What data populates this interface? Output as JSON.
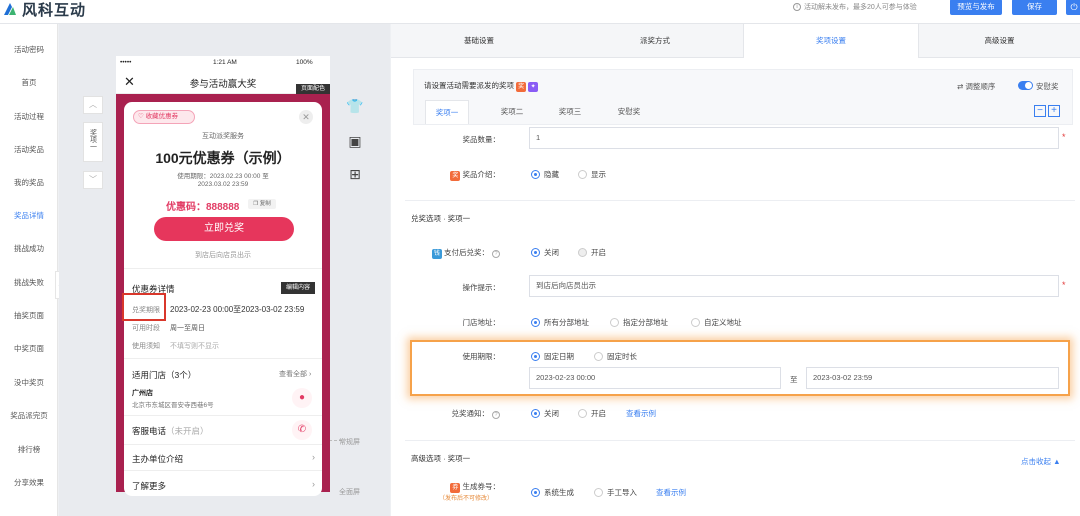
{
  "app": {
    "logo_text": "风科互动",
    "notice": "活动解未发布，最多20人可参与体验",
    "btn_preview": "预览与发布",
    "btn_save": "保存",
    "power_icon": "power-icon"
  },
  "sidebar": {
    "items": [
      {
        "label": "活动密码"
      },
      {
        "label": "首页"
      },
      {
        "label": "活动过程"
      },
      {
        "label": "活动奖品"
      },
      {
        "label": "我的奖品"
      },
      {
        "label": "奖品详情",
        "active": true
      },
      {
        "label": "挑战成功"
      },
      {
        "label": "挑战失败"
      },
      {
        "label": "抽奖页面"
      },
      {
        "label": "中奖页面"
      },
      {
        "label": "没中奖页"
      },
      {
        "label": "奖品派完页"
      },
      {
        "label": "排行榜"
      },
      {
        "label": "分享效果"
      }
    ],
    "collapse": "«"
  },
  "canvas": {
    "prize_tab": "奖项一",
    "normal_screen": "常规屏",
    "full_screen": "全面屏"
  },
  "phone": {
    "carrier": "•••••",
    "time": "1:21 AM",
    "battery": "100%",
    "nav_title": "参与活动赢大奖",
    "page_color": "页面配色",
    "coupon_tag": "收藏优惠券",
    "service": "互动派奖服务",
    "coupon_title": "100元优惠券（示例）",
    "validity_line1": "使用期限：2023.02.23 00:00 至",
    "validity_line2": "2023.03.02 23:59",
    "redeem_code": "优惠码：888888",
    "copy": "复制",
    "redeem_btn": "立即兑奖",
    "redeem_hint": "到店后向店员出示",
    "detail_title": "优惠券详情",
    "edit_btn": "编辑内容",
    "redeem_period_label": "兑奖期限",
    "redeem_period_value": "2023-02-23 00:00至2023-03-02 23:59",
    "avail_label": "可用时段",
    "avail_value": "周一至周日",
    "notice_label": "使用须知",
    "notice_value": "不填写则不显示",
    "stores_title": "适用门店（3个）",
    "view_all": "查看全部",
    "store_name": "广州店",
    "store_addr": "北京市东城区晋安寺西巷6号",
    "service_phone": "客服电话",
    "service_phone_status": "（未开启）",
    "sponsor": "主办单位介绍",
    "more": "了解更多"
  },
  "tabs": [
    {
      "label": "基础设置"
    },
    {
      "label": "派奖方式"
    },
    {
      "label": "奖项设置",
      "active": true
    },
    {
      "label": "高级设置"
    }
  ],
  "prize_panel": {
    "title": "请设置活动需要派发的奖项",
    "reorder": "调整顺序",
    "consolation": "安慰奖",
    "subtabs": [
      {
        "label": "奖项一",
        "active": true
      },
      {
        "label": "奖项二"
      },
      {
        "label": "奖项三"
      },
      {
        "label": "安慰奖"
      }
    ],
    "minus": "−",
    "plus": "+"
  },
  "form": {
    "quantity_label": "奖品数量：",
    "quantity_value": "1",
    "intro_label": "奖品介绍：",
    "intro_hide": "隐藏",
    "intro_show": "显示",
    "redeem_section": "兑奖选项 · 奖项一",
    "pay_label": "支付后兑奖：",
    "pay_off": "关闭",
    "pay_on": "开启",
    "tip_label": "操作提示：",
    "tip_value": "到店后向店员出示",
    "store_label": "门店地址：",
    "store_all": "所有分部地址",
    "store_some": "指定分部地址",
    "store_custom": "自定义地址",
    "period_label": "使用期限：",
    "period_fixed_date": "固定日期",
    "period_fixed_len": "固定时长",
    "period_start": "2023-02-23 00:00",
    "period_to": "至",
    "period_end": "2023-03-02 23:59",
    "notify_label": "兑奖通知：",
    "notify_off": "关闭",
    "notify_on": "开启",
    "notify_example": "查看示例",
    "advanced_section": "高级选项 · 奖项一",
    "collapse_link": "点击收起 ▲",
    "coupon_label": "生成券号：",
    "coupon_hint": "（发布后不可修改）",
    "coupon_system": "系统生成",
    "coupon_manual": "手工导入",
    "coupon_example": "查看示例"
  },
  "colors": {
    "accent": "#3a7ff0",
    "phone_theme": "#a9214f",
    "highlight_orange": "#f6a24a",
    "highlight_red": "#d9372b"
  }
}
